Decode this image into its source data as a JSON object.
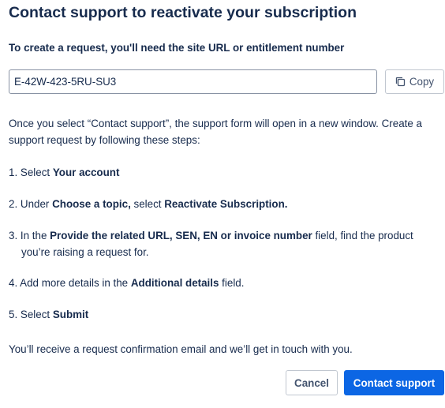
{
  "dialog": {
    "title": "Contact support to reactivate your subscription",
    "request_label": "To create a request, you'll need the site URL or entitlement number",
    "entitlement_value": "E-42W-423-5RU-SU3",
    "copy_label": "Copy",
    "copy_icon": "copy-icon",
    "intro": "Once you select “Contact support”, the support form will open in a new window. Create a support request by following these steps:",
    "steps": [
      {
        "num": "1.",
        "pre": " Select ",
        "bold": "Your account"
      },
      {
        "num": "2.",
        "pre": " Under ",
        "bold1": "Choose a topic,",
        "mid": " select ",
        "bold2": "Reactivate Subscription."
      },
      {
        "num": "3.",
        "pre": " In the ",
        "bold": "Provide the related URL, SEN, EN or invoice number",
        "post": " field, find the product",
        "line2": "you’re raising a request for."
      },
      {
        "num": "4.",
        "pre": " Add more details in the ",
        "bold": "Additional details",
        "post": " field."
      },
      {
        "num": "5.",
        "pre": " Select ",
        "bold": "Submit"
      }
    ],
    "outro": "You’ll receive a request confirmation email and we’ll get in touch with you.",
    "cancel_label": "Cancel",
    "contact_label": "Contact support"
  },
  "colors": {
    "text": "#172b4d",
    "primary_button": "#0c66e4",
    "border": "#8993a4"
  }
}
